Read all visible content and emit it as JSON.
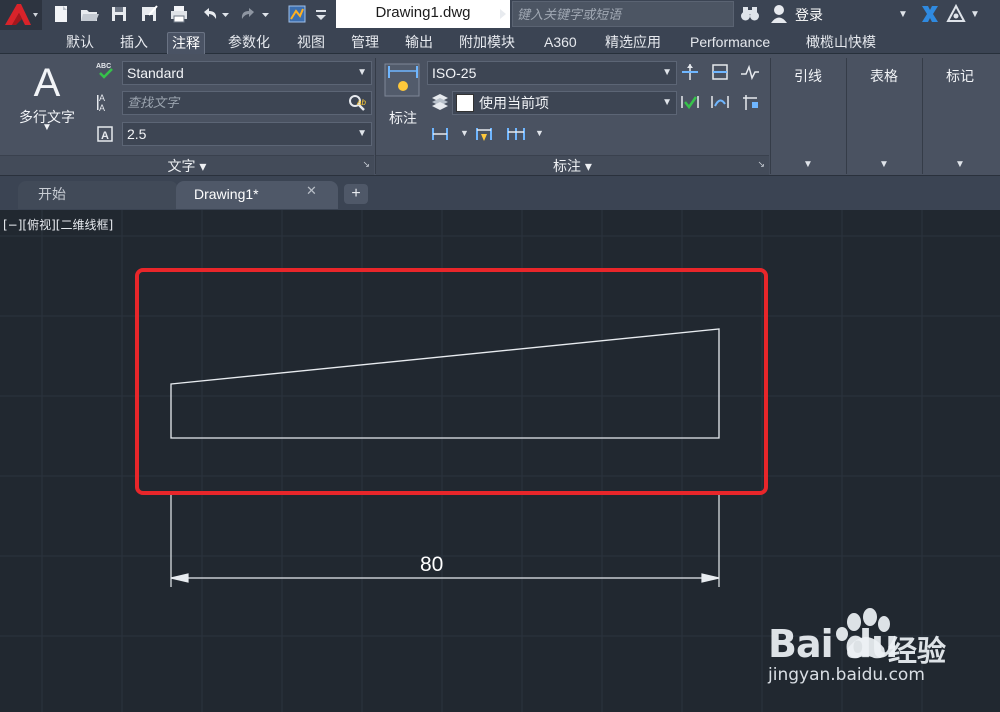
{
  "titlebar": {
    "doc_title": "Drawing1.dwg",
    "search_placeholder": "键入关键字或短语",
    "login_label": "登录"
  },
  "ribbon_tabs": [
    "默认",
    "插入",
    "注释",
    "参数化",
    "视图",
    "管理",
    "输出",
    "附加模块",
    "A360",
    "精选应用",
    "Performance",
    "橄榄山快模"
  ],
  "active_tab": "注释",
  "text_panel": {
    "big_button_label": "多行文字",
    "style_value": "Standard",
    "find_placeholder": "查找文字",
    "height_value": "2.5",
    "footer_label": "文字 ▾"
  },
  "dim_panel": {
    "big_button_label": "标注",
    "dim_style_value": "ISO-25",
    "layer_value": "使用当前项",
    "footer_label": "标注 ▾"
  },
  "side_panels": [
    "引线",
    "表格",
    "标记"
  ],
  "doc_tabs": {
    "start_label": "开始",
    "drawing_label": "Drawing1*"
  },
  "canvas": {
    "viewport_label": "[−][俯视][二维线框]",
    "dimension_value": "80",
    "highlight_color": "#e8262a"
  },
  "watermark": {
    "brand": "Bai  du",
    "cn": "经验",
    "url": "jingyan.baidu.com"
  }
}
